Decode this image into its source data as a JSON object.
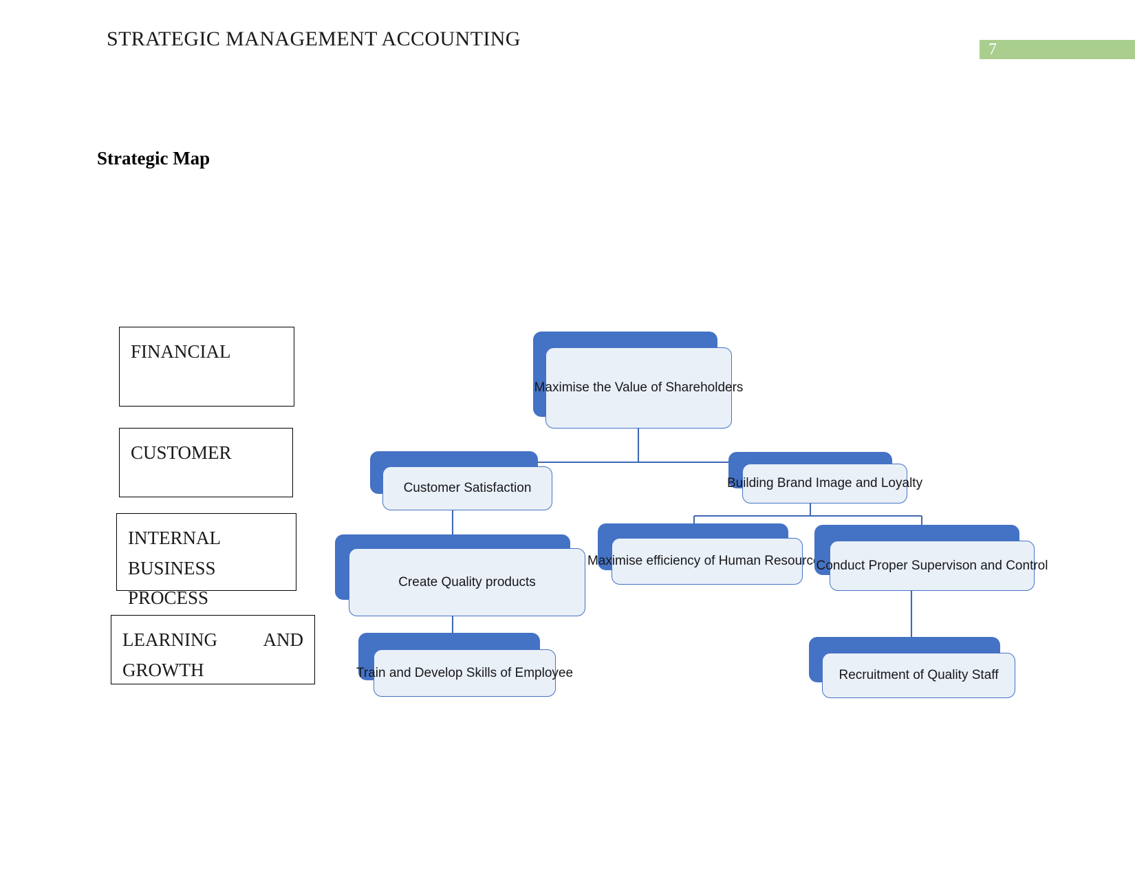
{
  "header": {
    "title": "STRATEGIC MANAGEMENT ACCOUNTING",
    "page_number": "7",
    "page_number_bar_color": "#a9ce8e"
  },
  "section": {
    "heading": "Strategic Map"
  },
  "perspectives": [
    {
      "id": "financial",
      "lines": [
        "FINANCIAL"
      ]
    },
    {
      "id": "customer",
      "lines": [
        "CUSTOMER"
      ]
    },
    {
      "id": "internal",
      "lines": [
        "INTERNAL",
        "BUSINESS PROCESS"
      ]
    },
    {
      "id": "learning",
      "lines": [
        "LEARNING",
        "AND",
        "GROWTH"
      ]
    }
  ],
  "perspective_labels": {
    "financial": "FINANCIAL",
    "customer": "CUSTOMER",
    "internal_line1": "INTERNAL",
    "internal_line2": "BUSINESS PROCESS",
    "learning_line1a": "LEARNING",
    "learning_line1b": "AND",
    "learning_line2": "GROWTH"
  },
  "map": {
    "node_fill": "#eaf0f8",
    "node_accent": "#4472c4",
    "nodes": {
      "shareholders": "Maximise the Value of Shareholders",
      "customer_satisfaction": "Customer Satisfaction",
      "brand_image": "Building Brand Image and Loyalty",
      "create_quality": "Create Quality products",
      "hr_efficiency": "Maximise efficiency of Human Resources",
      "supervision": "Conduct Proper Supervison and Control",
      "train_employee": "Train and Develop Skills of Employee",
      "recruitment": "Recruitment of Quality Staff"
    }
  }
}
